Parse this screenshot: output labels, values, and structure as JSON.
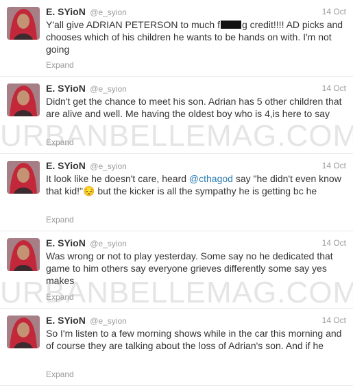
{
  "colors": {
    "name": "#333333",
    "meta": "#999999",
    "link": "#2a7ab0",
    "divider": "#e8e8e8"
  },
  "watermark": "URBANBELLEMAG.COM",
  "tweets": [
    {
      "fullname": "E. SYioN",
      "username": "@e_syion",
      "time": "14 Oct",
      "text_before": "Y'all give ADRIAN PETERSON to much f",
      "text_after": "g credit!!!! AD picks and chooses which of his children he wants to be hands on with. I'm not going",
      "expand": "Expand"
    },
    {
      "fullname": "E. SYioN",
      "username": "@e_syion",
      "time": "14 Oct",
      "text": "Didn't get the chance to meet his son. Adrian has 5 other children that are alive and well. Me having the oldest boy who is 4,is here to say",
      "expand": "Expand"
    },
    {
      "fullname": "E. SYioN",
      "username": "@e_syion",
      "time": "14 Oct",
      "text_before": "It look like he doesn't care, heard ",
      "mention": "@cthagod",
      "text_after": " say \"he didn't even know that kid!\"😔 but the kicker is all the sympathy he is getting bc he",
      "expand": "Expand"
    },
    {
      "fullname": "E. SYioN",
      "username": "@e_syion",
      "time": "14 Oct",
      "text": "Was wrong or not to play yesterday. Some say no he dedicated that game to him others say everyone grieves differently some say yes makes",
      "expand": "Expand"
    },
    {
      "fullname": "E. SYioN",
      "username": "@e_syion",
      "time": "14 Oct",
      "text": "So I'm listen to a few morning shows while in the car this morning and of course they are talking about the loss of Adrian's son. And if he",
      "expand": "Expand"
    }
  ]
}
